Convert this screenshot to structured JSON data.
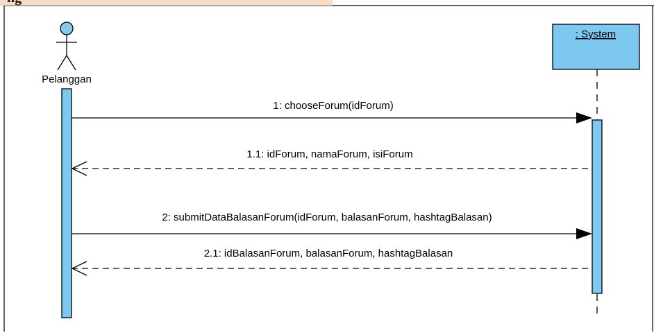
{
  "header": {
    "title_fragment": "ng"
  },
  "actor": {
    "label": "Pelanggan"
  },
  "system": {
    "label": ": System"
  },
  "messages": [
    {
      "number": "1",
      "text": "1: chooseForum(idForum)",
      "kind": "call"
    },
    {
      "number": "1.1",
      "text": "1.1: idForum, namaForum, isiForum",
      "kind": "return"
    },
    {
      "number": "2",
      "text": "2: submitDataBalasanForum(idForum, balasanForum, hashtagBalasan)",
      "kind": "call"
    },
    {
      "number": "2.1",
      "text": "2.1: idBalasanForum, balasanForum, hashtagBalasan",
      "kind": "return"
    }
  ],
  "colors": {
    "activation_fill": "#7dc8ef",
    "actor_head_fill": "#86c9ea",
    "system_box_fill": "#7dc8ef",
    "frame_tab": "#f7dcc8",
    "line": "#000000"
  }
}
